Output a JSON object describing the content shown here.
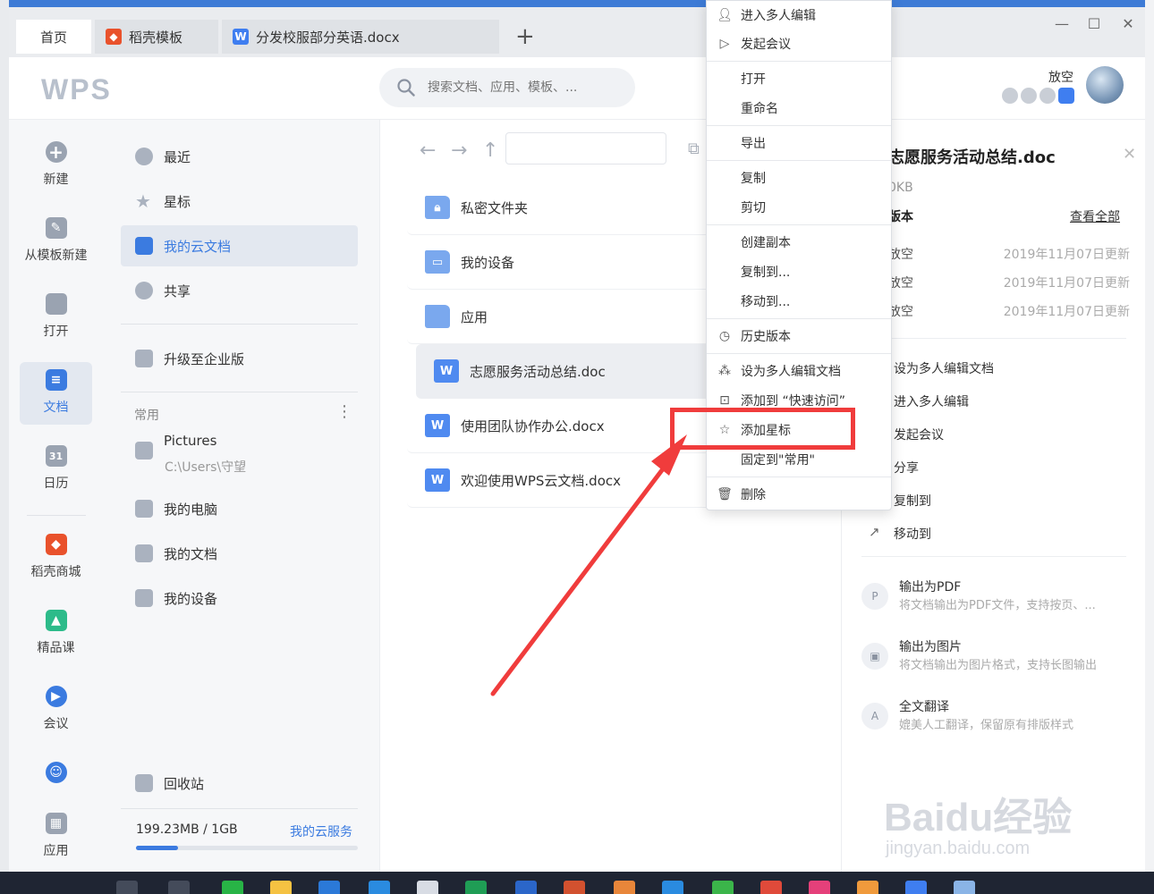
{
  "tabs": [
    {
      "label": "首页",
      "active": true
    },
    {
      "label": "稻壳模板",
      "icon": "daoke-icon"
    },
    {
      "label": "分发校服部分英语.docx",
      "icon": "word-doc-icon"
    }
  ],
  "header": {
    "logo": "WPS",
    "search_placeholder": "搜索文档、应用、模板、...",
    "username": "放空"
  },
  "rail": [
    {
      "label": "新建",
      "icon": "plus-icon"
    },
    {
      "label": "从模板新建",
      "icon": "template-icon"
    },
    {
      "label": "打开",
      "icon": "folder-open-icon"
    },
    {
      "label": "文档",
      "icon": "document-icon",
      "active": true
    },
    {
      "label": "日历",
      "icon": "calendar-icon",
      "number": "31"
    },
    {
      "label": "稻壳商城",
      "icon": "daoke-store-icon"
    },
    {
      "label": "精品课",
      "icon": "course-icon"
    },
    {
      "label": "会议",
      "icon": "meeting-icon"
    },
    {
      "label": "",
      "icon": "assistant-icon"
    },
    {
      "label": "应用",
      "icon": "apps-icon"
    }
  ],
  "nav": {
    "items": [
      {
        "label": "最近",
        "icon": "clock-icon"
      },
      {
        "label": "星标",
        "icon": "star-icon"
      },
      {
        "label": "我的云文档",
        "icon": "cloud-box-icon",
        "active": true
      },
      {
        "label": "共享",
        "icon": "people-icon"
      }
    ],
    "upgrade": "升级至企业版",
    "section_title": "常用",
    "frequent": [
      {
        "label": "Pictures",
        "sub": "C:\\Users\\守望"
      },
      {
        "label": "我的电脑"
      },
      {
        "label": "我的文档"
      },
      {
        "label": "我的设备"
      }
    ],
    "recycle": "回收站",
    "storage_text": "199.23MB / 1GB",
    "storage_link": "我的云服务",
    "storage_fraction": 0.19
  },
  "files": [
    {
      "name": "私密文件夹",
      "type": "folder-lock"
    },
    {
      "name": "我的设备",
      "type": "folder-device"
    },
    {
      "name": "应用",
      "type": "folder"
    },
    {
      "name": "志愿服务活动总结.doc",
      "type": "doc",
      "selected": true
    },
    {
      "name": "使用团队协作办公.docx",
      "type": "doc"
    },
    {
      "name": "欢迎使用WPS云文档.docx",
      "type": "doc"
    }
  ],
  "details": {
    "title": "志愿服务活动总结.doc",
    "size": "0KB",
    "version_label": "版本",
    "view_all": "查看全部",
    "history": [
      {
        "user": "放空",
        "time": "2019年11月07日更新"
      },
      {
        "user": "放空",
        "time": "2019年11月07日更新"
      },
      {
        "user": "放空",
        "time": "2019年11月07日更新"
      }
    ],
    "actions": [
      "设为多人编辑文档",
      "进入多人编辑",
      "发起会议",
      "分享",
      "复制到",
      "移动到"
    ],
    "outputs": [
      {
        "title": "输出为PDF",
        "desc": "将文档输出为PDF文件，支持按页、..."
      },
      {
        "title": "输出为图片",
        "desc": "将文档输出为图片格式，支持长图输出"
      },
      {
        "title": "全文翻译",
        "desc": "媲美人工翻译，保留原有排版样式"
      }
    ]
  },
  "menu": {
    "items": [
      {
        "label": "进入多人编辑",
        "icon": "user-edit-icon"
      },
      {
        "label": "发起会议",
        "icon": "video-icon"
      },
      {
        "label": "打开"
      },
      {
        "label": "重命名"
      },
      {
        "label": "导出"
      },
      {
        "label": "复制"
      },
      {
        "label": "剪切"
      },
      {
        "label": "创建副本"
      },
      {
        "label": "复制到..."
      },
      {
        "label": "移动到..."
      },
      {
        "label": "历史版本",
        "icon": "history-icon"
      },
      {
        "label": "设为多人编辑文档",
        "icon": "share-nodes-icon"
      },
      {
        "label": "添加到 “快速访问”",
        "icon": "quick-access-icon"
      },
      {
        "label": "添加星标",
        "icon": "star-outline-icon"
      },
      {
        "label": "固定到\"常用\""
      },
      {
        "label": "删除",
        "icon": "trash-icon"
      }
    ]
  },
  "watermark": {
    "text": "Baidu经验",
    "sub": "jingyan.baidu.com"
  },
  "colors": {
    "accent": "#3b7be0",
    "highlight": "#f03c3c"
  }
}
